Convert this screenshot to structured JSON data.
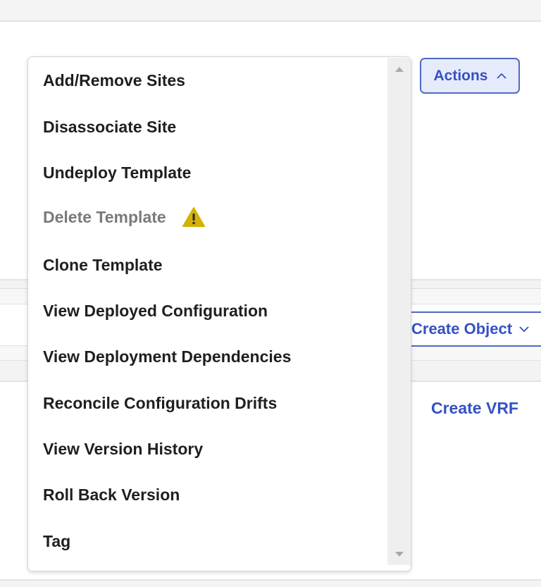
{
  "header": {
    "actions_label": "Actions"
  },
  "toolbar": {
    "create_object_label": "Create Object"
  },
  "content": {
    "create_vrf_label": "Create VRF"
  },
  "actions_menu": {
    "items": [
      {
        "label": "Add/Remove Sites",
        "disabled": false
      },
      {
        "label": "Disassociate Site",
        "disabled": false
      },
      {
        "label": "Undeploy Template",
        "disabled": false
      },
      {
        "label": "Delete Template",
        "disabled": true,
        "icon": "warning-icon"
      },
      {
        "label": "Clone Template",
        "disabled": false
      },
      {
        "label": "View Deployed Configuration",
        "disabled": false
      },
      {
        "label": "View Deployment Dependencies",
        "disabled": false
      },
      {
        "label": "Reconcile Configuration Drifts",
        "disabled": false
      },
      {
        "label": "View Version History",
        "disabled": false
      },
      {
        "label": "Roll Back Version",
        "disabled": false
      },
      {
        "label": "Tag",
        "disabled": false
      }
    ]
  },
  "colors": {
    "accent": "#3551c3",
    "warning": "#d4b106",
    "disabled_text": "#7a7a7a"
  }
}
